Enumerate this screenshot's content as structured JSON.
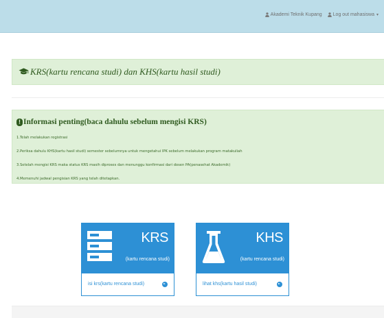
{
  "navbar": {
    "user_link": "Akademi Teknik Kupang",
    "logout_link": "Log out mahasiswa"
  },
  "title_panel": {
    "title": "KRS(kartu rencana studi) dan KHS(kartu hasil studi)",
    "icon": "graduation-cap-icon"
  },
  "info_panel": {
    "heading": "Informasi penting(baca dahulu sebelum mengisi KRS)",
    "icon": "exclamation-icon",
    "items": [
      "1.Telah melakukan registrasi",
      "2.Periksa dahulu KHS(kartu hasil studi) semester sebelumnya untuk mengetahui IPK sebelum melakukan program matakuliah",
      "3.Setelah mengisi KRS maka status KRS masih diproses dan menunggu konfirmasi dari dosen PA(penasehat Akademik)",
      "4.Memenuhi jadwal pengisian KRS yang telah ditetapkan."
    ]
  },
  "cards": [
    {
      "big_label": "KRS",
      "small_label": "(kartu rencana studi)",
      "footer_label": "isi krs(kartu rencana studi)",
      "icon": "server-list-icon"
    },
    {
      "big_label": "KHS",
      "small_label": "(kartu rencana studi)",
      "footer_label": "lihat khs(kartu hasil studi)",
      "icon": "flask-icon"
    }
  ],
  "colors": {
    "navbar_bg": "#bcdde9",
    "success_panel_bg": "#dff0d8",
    "card_primary": "#2d90d5"
  }
}
